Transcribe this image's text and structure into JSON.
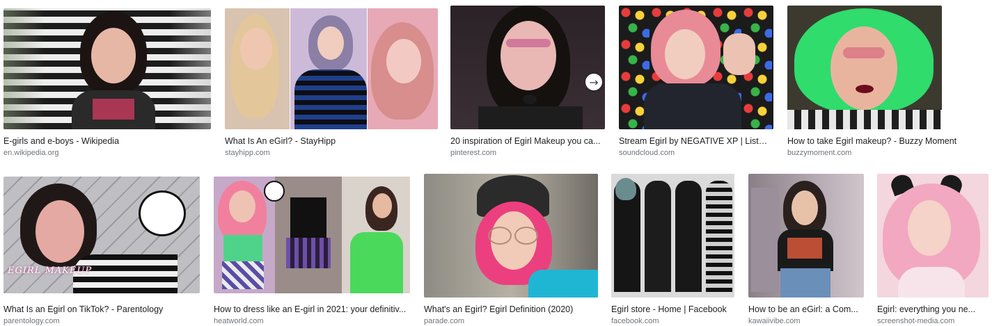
{
  "results": [
    {
      "title": "E-girls and e-boys - Wikipedia",
      "source": "en.wikipedia.org"
    },
    {
      "title": "What Is An eGirl? - StayHipp",
      "source": "stayhipp.com"
    },
    {
      "title": "20 inspiration of Egirl Makeup you ca...",
      "source": "pinterest.com"
    },
    {
      "title": "Stream Egirl by NEGATIVE XP | Listen...",
      "source": "soundcloud.com"
    },
    {
      "title": "How to take Egirl makeup? - Buzzy Moment",
      "source": "buzzymoment.com"
    },
    {
      "title": "What Is an Egirl on TikTok? - Parentology",
      "source": "parentology.com"
    },
    {
      "title": "How to dress like an E-girl in 2021: your definitiv...",
      "source": "heatworld.com"
    },
    {
      "title": "What's an Egirl? Egirl Definition (2020)",
      "source": "parade.com"
    },
    {
      "title": "Egirl store - Home | Facebook",
      "source": "facebook.com"
    },
    {
      "title": "How to be an eGirl: a Com...",
      "source": "kawaiivibe.com"
    },
    {
      "title": "Egirl: everything you ne...",
      "source": "screenshot-media.com"
    }
  ],
  "overlay": {
    "makeup_caption": "EGIRL MAKEUP"
  },
  "icons": {
    "next_arrow": "arrow-right-icon"
  }
}
